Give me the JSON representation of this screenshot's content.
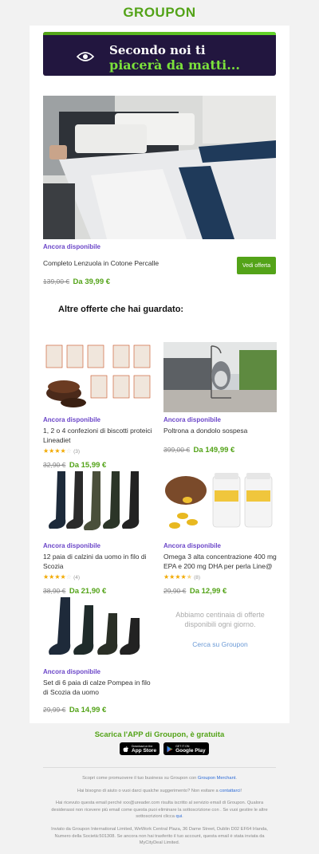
{
  "brand": {
    "logo": "GROUPON",
    "green": "#53a318",
    "purple": "#6b46c8"
  },
  "banner": {
    "line1": "Secondo noi ti",
    "line2": "piacerà da matti...",
    "icon": "eye-icon"
  },
  "hero": {
    "available": "Ancora disponibile",
    "title": "Completo Lenzuola in Cotone Percalle",
    "old_price": "139,00 €",
    "new_price": "Da 39,99 €",
    "button": "Vedi offerta"
  },
  "section_title": "Altre offerte che hai guardato:",
  "deals": [
    {
      "available": "Ancora disponibile",
      "title": "1, 2 o 4 confezioni di biscotti proteici Lineadiet",
      "rating": 4,
      "reviews": "(3)",
      "old_price": "32,90 €",
      "new_price": "Da 15,99 €"
    },
    {
      "available": "Ancora disponibile",
      "title": "Poltrona a dondolo sospesa",
      "old_price": "399,00 €",
      "new_price": "Da 149,99 €"
    },
    {
      "available": "Ancora disponibile",
      "title": "12 paia di calzini da uomo in filo di Scozia",
      "rating": 4,
      "reviews": "(4)",
      "old_price": "38,90 €",
      "new_price": "Da 21,90 €"
    },
    {
      "available": "Ancora disponibile",
      "title": "Omega 3 alta concentrazione 400 mg EPA e 200 mg DHA per perla Line@",
      "rating": 4.5,
      "reviews": "(8)",
      "old_price": "29,90 €",
      "new_price": "Da 12,99 €"
    },
    {
      "available": "Ancora disponibile",
      "title": "Set di 6 paia di calze Pompea in filo di Scozia da uomo",
      "old_price": "29,99 €",
      "new_price": "Da 14,99 €"
    }
  ],
  "more": {
    "text": "Abbiamo centinaia di offerte disponibili ogni giorno.",
    "link": "Cerca su Groupon"
  },
  "app": {
    "title": "Scarica l'APP di Groupon, è gratuita",
    "appstore_small": "Download on the",
    "appstore_big": "App Store",
    "googleplay_small": "GET IT ON",
    "googleplay_big": "Google Play"
  },
  "footer": {
    "p1_pre": "Scopri come promuovere il tuo business su Groupon con ",
    "p1_link": "Groupon Merchant",
    "p1_post": ".",
    "p2_pre": "Hai bisogno di aiuto o vuoi darci qualche suggerimento? Non esitare a ",
    "p2_link": "contattarci",
    "p2_post": "!",
    "p3_pre": "Hai ricevuto questa email perché xxx@ureader.com risulta iscritto al servizio email di Groupon. Qualora desiderassi non ricevere più email come questa puoi eliminare la sottoscrizione con . Se vuoi gestire le altre sottoscrizioni clicca ",
    "p3_link": "qui",
    "p3_post": ".",
    "p4": "Inviato da Groupon International Limited, WeWork Central Plaza, 36 Dame Street, Dublin D02 EF64 Irlanda, Numero della Società:501308. Se ancora non hai trasferito il tuo account, questa email è stata inviata da MyCityDeal Limited."
  }
}
